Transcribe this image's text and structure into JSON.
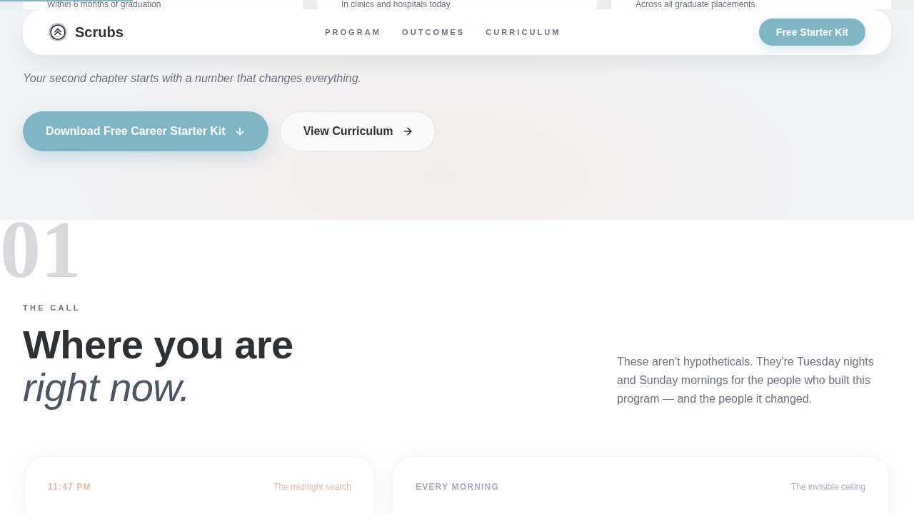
{
  "reading_progress": {
    "level": 0.145
  },
  "stats": [
    {
      "caption": "Within 6 months of graduation"
    },
    {
      "caption": "In clinics and hospitals today"
    },
    {
      "caption": "Across all graduate placements"
    }
  ],
  "nav": {
    "brand": "Scrubs",
    "links": [
      "PROGRAM",
      "OUTCOMES",
      "CURRICULUM"
    ],
    "cta": "Free Starter Kit"
  },
  "hero": {
    "tagline": "Your second chapter starts with a number that changes everything.",
    "buttons": [
      {
        "label": "Download Free Career Starter Kit",
        "kind": "primary"
      },
      {
        "label": "View Curriculum",
        "kind": "secondary"
      }
    ]
  },
  "section": {
    "number": "01",
    "eyebrow": "THE CALL",
    "title": "Where you are",
    "title_emphasis": "right now.",
    "intro": "These aren't hypotheticals. They're Tuesday nights and Sunday mornings for the people who built this program — and the people it changed.",
    "cards": [
      {
        "time": "11:47 PM",
        "tag": "The midnight search",
        "color": "#e2b9a8"
      },
      {
        "time": "EVERY MORNING",
        "tag": "The invisible ceiling",
        "color": "#aba8c4"
      }
    ]
  }
}
